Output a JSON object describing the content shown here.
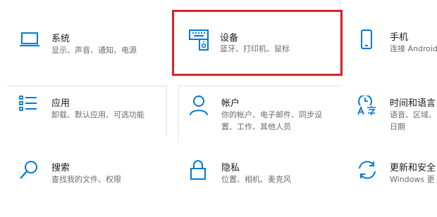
{
  "settings": {
    "accent_color": "#0078d7",
    "highlight_color": "#d9232a",
    "tiles": [
      {
        "id": "system",
        "title": "系统",
        "desc": [
          "显示、声音、通知、电源"
        ],
        "icon": "laptop-icon"
      },
      {
        "id": "devices",
        "title": "设备",
        "desc": [
          "蓝牙、打印机、鼠标"
        ],
        "icon": "keyboard-speaker-icon"
      },
      {
        "id": "phone",
        "title": "手机",
        "desc": [
          "连接 Android"
        ],
        "icon": "phone-icon"
      },
      {
        "id": "apps",
        "title": "应用",
        "desc": [
          "卸载、默认应用、可选功能"
        ],
        "icon": "apps-list-icon"
      },
      {
        "id": "accounts",
        "title": "帐户",
        "desc": [
          "你的帐户、电子邮件、同步设",
          "置、工作、其他人员"
        ],
        "icon": "person-icon"
      },
      {
        "id": "time-language",
        "title": "时间和语言",
        "desc": [
          "语音、区域、",
          "日期"
        ],
        "icon": "time-language-icon"
      },
      {
        "id": "search",
        "title": "搜索",
        "desc": [
          "查找我的文件、权限"
        ],
        "icon": "search-icon"
      },
      {
        "id": "privacy",
        "title": "隐私",
        "desc": [
          "位置、相机、麦克风"
        ],
        "icon": "lock-icon"
      },
      {
        "id": "update-security",
        "title": "更新和安全",
        "desc": [
          "Windows 更"
        ],
        "icon": "sync-icon"
      }
    ]
  }
}
